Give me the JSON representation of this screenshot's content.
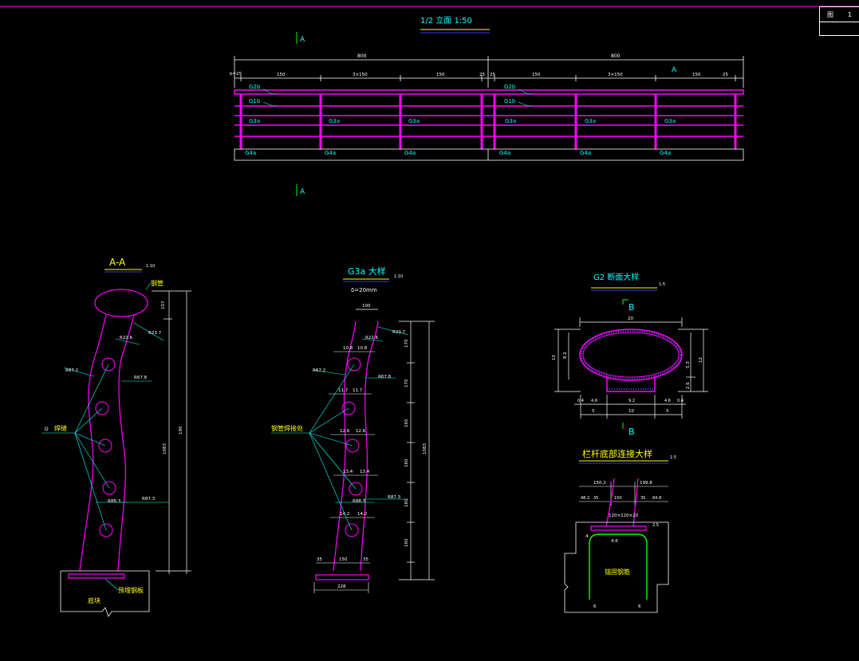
{
  "elevation": {
    "title": "1/2  立面 1:50",
    "section_mark": "A",
    "dims_total": [
      "800",
      "800"
    ],
    "dims_left": [
      "b=25",
      "150",
      "3×150",
      "150",
      "25"
    ],
    "dims_right": [
      "25",
      "150",
      "3×150",
      "150",
      "25"
    ],
    "labels": {
      "g2b": "G2b",
      "g1b": "G1b",
      "g3a": "G3a",
      "g4a": "G4a"
    }
  },
  "section_aa": {
    "title": "A-A",
    "scale": "1:10",
    "callouts": {
      "steel_pipe": "钢管",
      "weld": "焊缝",
      "anchor": "预埋钢板",
      "base": "底块"
    },
    "radii": [
      "R23.7",
      "R22.6",
      "R67.2",
      "R67.8",
      "R88.3",
      "R87.3"
    ],
    "dims_right": [
      "107",
      "190",
      "1083"
    ]
  },
  "g3a_detail": {
    "title": "G3a 大样",
    "scale": "1:10",
    "subtitle": "δ=20mm",
    "callout": "钢管焊接处",
    "top_width": "100",
    "bottom_dims": [
      "35",
      "150",
      "35"
    ],
    "base_width": "228",
    "radii": [
      "R23.7",
      "R22.6",
      "R67.2",
      "R67.8",
      "R88.3",
      "R87.3"
    ],
    "inner_dims": [
      "10.8",
      "10.8",
      "11.7",
      "11.7",
      "12.6",
      "12.6",
      "13.4",
      "13.4",
      "14.2",
      "14.2"
    ],
    "right_dims": [
      "170",
      "170",
      "160",
      "160",
      "160",
      "160",
      "1083"
    ]
  },
  "g2_section": {
    "title": "G2 断面大样",
    "scale": "1:5",
    "section_mark": "B",
    "top_width": "20",
    "left_dims": [
      "10",
      "8.2"
    ],
    "right_dims": [
      "5.3",
      "12",
      "2.6"
    ],
    "bottom_dims_1": [
      "0.4",
      "4.6",
      "9.2",
      "4.6",
      "0.4"
    ],
    "bottom_dims_2": [
      "5",
      "10",
      "5"
    ]
  },
  "base_detail": {
    "title": "栏杆底部连接大样",
    "scale": "1:5",
    "top_dims": [
      "150.2",
      "199.8"
    ],
    "mid_dims": [
      "48.2",
      "35",
      "150",
      "35",
      "84.8"
    ],
    "plate": "120×120×20",
    "dim_4": "4",
    "dim_46": "4.6",
    "anchor_label": "锚固钢筋",
    "bottom_dims": [
      "6",
      "6"
    ],
    "side_dim": "2.5"
  },
  "title_block": {
    "left": "图",
    "right": "1"
  },
  "colors": {
    "bg": "#000000",
    "magenta": "#ff00ff",
    "cyan": "#00ffff",
    "yellow": "#ffff00",
    "green": "#00ff00",
    "white": "#ffffff",
    "blue": "#3333ff"
  }
}
